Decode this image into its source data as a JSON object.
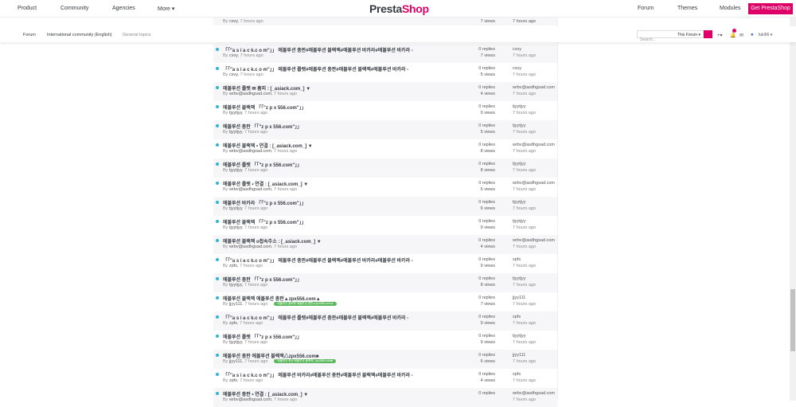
{
  "nav": {
    "left": [
      "Product",
      "Community",
      "Agencies",
      "More ▾"
    ],
    "logo_a": "Presta",
    "logo_b": "Shop",
    "right": [
      "Forum",
      "Themes",
      "Modules"
    ],
    "cta": "Get PrestaShop"
  },
  "breadcrumb": [
    "Forum",
    "International community (English)",
    "General topics"
  ],
  "search": {
    "placeholder": "Search...",
    "scope": "This Forum ▾"
  },
  "user": {
    "name": "tuki56 ▾",
    "notifications": "1"
  },
  "top_partial": {
    "by": "csvy",
    "time": "7 hours ago",
    "views": "7 views",
    "last_time": "7 hours ago"
  },
  "topics": [
    {
      "title": "「「\"a s i a c k.c o m\"」」 에볼루션 총판#에볼루션 블랙잭#에볼루션 바카라#에볼루션 바카라 -",
      "author": "csvy",
      "replies": "0 replies",
      "views": "7 views",
      "last": "csvy"
    },
    {
      "title": "「「\"a s i a c k.c o m\"」」 에볼루션 룰렛#에볼루션 총판#에볼루션 블랙잭#에볼루션 바카라 -",
      "author": "csvy",
      "replies": "0 replies",
      "views": "5 views",
      "last": "csvy"
    },
    {
      "title": "에볼루션 룰렛 ✉ 홈피 : [_asiack.com_] ▼",
      "author": "wrbv@asdhgsad.com",
      "replies": "0 replies",
      "views": "4 views",
      "last": "wrbv@asdhgsad.com"
    },
    {
      "title": "에볼루션 블랙잭 「「\"z p x 556.com\"」」",
      "author": "tjyytjyy",
      "replies": "0 replies",
      "views": "9 views",
      "last": "tjyytjyy"
    },
    {
      "title": "에볼루션 총판 「「\"z p x 556.com\"」」",
      "author": "tjyytjyy",
      "replies": "0 replies",
      "views": "5 views",
      "last": "tjyytjyy"
    },
    {
      "title": "에볼루션 블랙잭 • 연결 : [_asiack.com_] ▼",
      "author": "wrbv@asdhgsad.com",
      "replies": "0 replies",
      "views": "8 views",
      "last": "wrbv@asdhgsad.com"
    },
    {
      "title": "에볼루션 룰렛 「「\"z p x 556.com\"」」",
      "author": "tjyytjyy",
      "replies": "0 replies",
      "views": "8 views",
      "last": "tjyytjyy"
    },
    {
      "title": "에볼루션 룰렛 • 연결 : [_asiack.com_] ▼",
      "author": "wrbv@asdhgsad.com",
      "replies": "0 replies",
      "views": "6 views",
      "last": "wrbv@asdhgsad.com"
    },
    {
      "title": "에볼루션 바카라 「「\"z p x 556.com\"」」",
      "author": "tjyytjyy",
      "replies": "0 replies",
      "views": "6 views",
      "last": "tjyytjyy"
    },
    {
      "title": "에볼루션 블랙잭 「「\"z p x 556.com\"」」",
      "author": "tjyytjyy",
      "replies": "0 replies",
      "views": "9 views",
      "last": "tjyytjyy"
    },
    {
      "title": "에볼루션 블랙잭 ο접속주소 : [_asiack.com_] ▼",
      "author": "wrbv@asdhgsad.com",
      "replies": "0 replies",
      "views": "4 views",
      "last": "wrbv@asdhgsad.com"
    },
    {
      "title": "「「\"a s i a c k.c o m\"」」 에볼루션 총판#에볼루션 블랙잭#에볼루션 바카라#에볼루션 바카라 -",
      "author": "zpfs",
      "replies": "0 replies",
      "views": "9 views",
      "last": "zpfs"
    },
    {
      "title": "에볼루션 총판 「「\"z p x 556.com\"」」",
      "author": "tjyytjyy",
      "replies": "0 replies",
      "views": "8 views",
      "last": "tjyytjyy"
    },
    {
      "title": "에볼루션 블랙잭 에볼루션 총판▲zpx556.com▲",
      "author": "jjyy111",
      "tag": "에볼루션 블랙잭 에볼루션 총판▲zpx556.com▲",
      "replies": "0 replies",
      "views": "7 views",
      "last": "jjyy111"
    },
    {
      "title": "「「\"a s i a c k.c o m\"」」 에볼루션 룰렛#에볼루션 총판#에볼루션 블랙잭#에볼루션 바카라 -",
      "author": "zpfs",
      "replies": "0 replies",
      "views": "9 views",
      "last": "zpfs"
    },
    {
      "title": "에볼루션 룰렛 「「\"z p x 556.com\"」」",
      "author": "tjyytjyy",
      "replies": "0 replies",
      "views": "9 views",
      "last": "tjyytjyy"
    },
    {
      "title": "에볼루션 총판 에볼루션 블랙잭△zpx556.com■",
      "author": "jjyy111",
      "tag": "에볼루션 총판 에볼루션 블랙잭△zpx556.com■",
      "replies": "0 replies",
      "views": "6 views",
      "last": "jjyy111"
    },
    {
      "title": "「「\"a s i a c k.c o m\"」」 에볼루션 바카라#에볼루션 총판#에볼루션 블랙잭#에볼루션 바카라 -",
      "author": "zpfs",
      "replies": "0 replies",
      "views": "4 views",
      "last": "zpfs"
    },
    {
      "title": "에볼루션 총판 • 연결 : [_asiack.com_] ▼",
      "author": "wrbv@asdhgsad.com",
      "replies": "0 replies",
      "views": "",
      "last": "wrbv@asdhgsad.com"
    }
  ],
  "labels": {
    "by": "By ",
    "time": ", 7 hours ago",
    "last_time": "7 hours ago"
  },
  "colors": {
    "accent": "#df0067",
    "unread": "#25b9d7"
  }
}
